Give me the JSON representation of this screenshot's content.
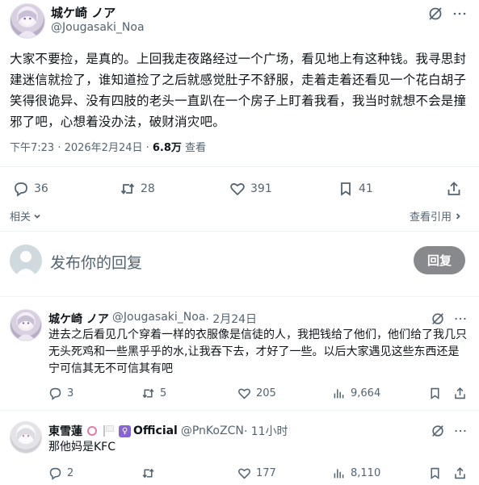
{
  "main_post": {
    "display_name": "城ケ崎 ノア",
    "handle": "@Jougasaki_Noa",
    "text": "大家不要捡，是真的。上回我走夜路经过一个广场，看见地上有这种钱。我寻思封建迷信就捡了，谁知道捡了之后就感觉肚子不舒服，走着走着还看见一个花白胡子笑得很诡异、没有四肢的老头一直趴在一个房子上盯着我看，我当时就想不会是撞邪了吧，心想着没办法，破财消灾吧。",
    "time": "下午7:23 · 2026年2月24日 · ",
    "views": "6.8万",
    "views_label": " 查看",
    "replies": "36",
    "reposts": "28",
    "likes": "391",
    "bookmarks": "41",
    "related_label": "相关",
    "quotes_label": "查看引用"
  },
  "compose": {
    "placeholder": "发布你的回复",
    "button_label": "回复"
  },
  "replies": [
    {
      "display_name": "城ケ崎 ノア",
      "handle": "@Jougasaki_Noa",
      "date": " · 2月24日",
      "text": "进去之后看见几个穿着一样的衣服像是信徒的人，我把钱给了他们，他们给了我几只无头死鸡和一些黑乎乎的水,让我吞下去，才好了一些。以后大家遇见这些东西还是宁可信其无不可信其有吧",
      "replies": "3",
      "reposts": "5",
      "likes": "205",
      "views": "9,664"
    },
    {
      "display_name": "東雪蓮",
      "badge": "Official",
      "handle": "@PnKoZCN",
      "date": " · 11小时",
      "text": "那他妈是KFC",
      "replies": "2",
      "likes": "177",
      "views": "8,110"
    }
  ],
  "colors": {
    "text": "#0f1419",
    "secondary": "#536471",
    "reply_button": "#87898c",
    "official_badge": "#8a62d8"
  }
}
